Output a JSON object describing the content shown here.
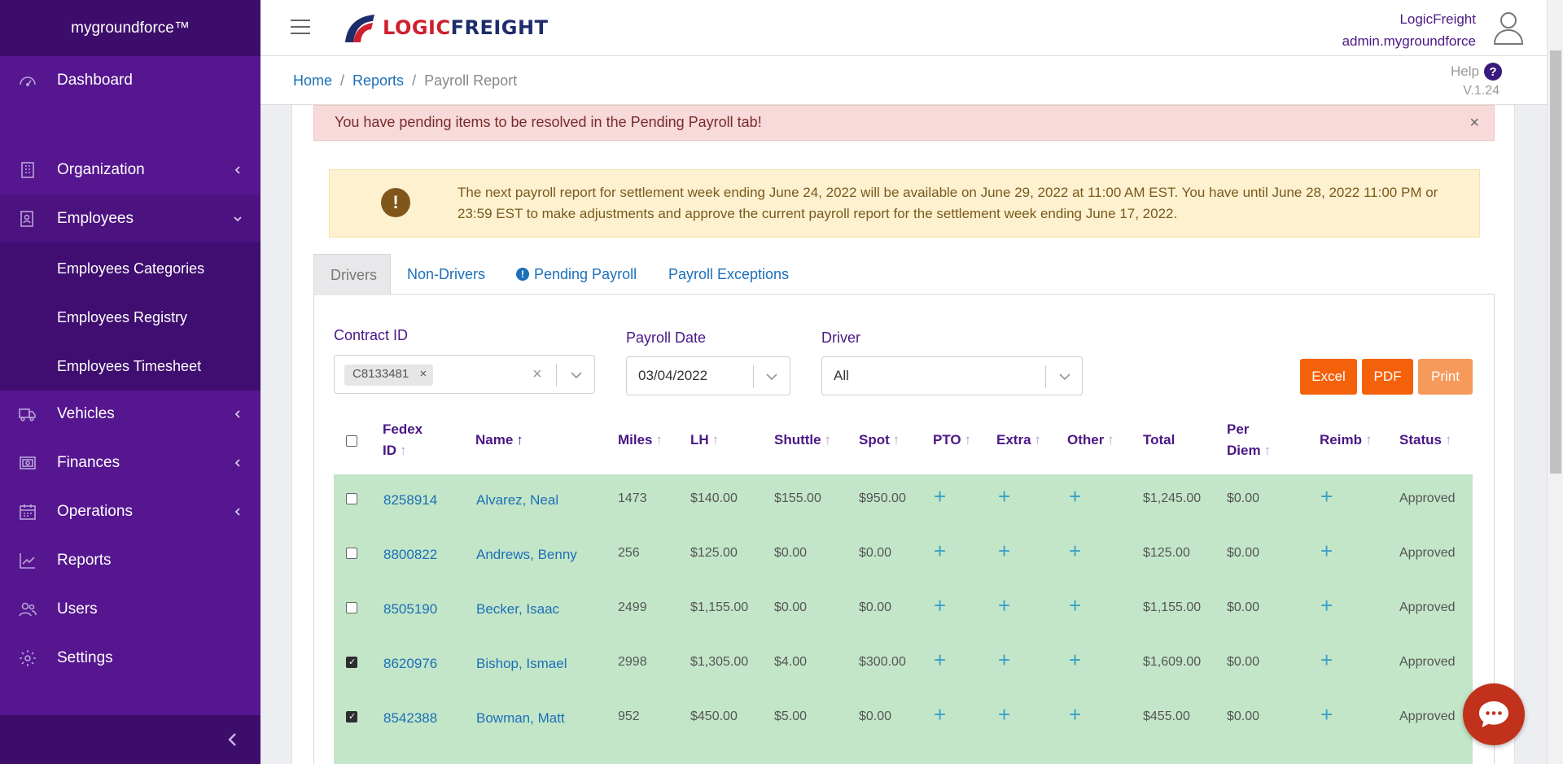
{
  "sidebar": {
    "brand": "mygroundforce™",
    "items": [
      {
        "label": "Dashboard",
        "icon": "dashboard-icon"
      },
      {
        "label": "Organization",
        "icon": "building-icon"
      },
      {
        "label": "Employees",
        "icon": "employees-icon"
      },
      {
        "label": "Vehicles",
        "icon": "truck-icon"
      },
      {
        "label": "Finances",
        "icon": "money-icon"
      },
      {
        "label": "Operations",
        "icon": "calendar-icon"
      },
      {
        "label": "Reports",
        "icon": "chart-icon"
      },
      {
        "label": "Users",
        "icon": "users-icon"
      },
      {
        "label": "Settings",
        "icon": "gear-icon"
      }
    ],
    "employees_sub": [
      "Employees Categories",
      "Employees Registry",
      "Employees Timesheet"
    ]
  },
  "topbar": {
    "logo_part1": "LOGIC",
    "logo_part2": "FREIGHT",
    "user_company": "LogicFreight",
    "user_account": "admin.mygroundforce"
  },
  "breadcrumb": {
    "home": "Home",
    "reports": "Reports",
    "current": "Payroll Report",
    "sep": "/"
  },
  "help": {
    "label": "Help",
    "icon": "?",
    "version": "V.1.24"
  },
  "alerts": {
    "pending": "You have pending items to be resolved in the Pending Payroll tab!",
    "close": "×",
    "notice": "The next payroll report for settlement week ending June 24, 2022 will be available on June 29, 2022 at 11:00 AM EST. You have until June 28, 2022 11:00 PM or 23:59 EST to make adjustments and approve the current payroll report for the settlement week ending June 17, 2022.",
    "notice_icon": "!"
  },
  "tabs": [
    {
      "label": "Drivers",
      "active": true
    },
    {
      "label": "Non-Drivers",
      "active": false
    },
    {
      "label": "Pending Payroll",
      "active": false,
      "warn": "!"
    },
    {
      "label": "Payroll Exceptions",
      "active": false
    }
  ],
  "filters": {
    "contract_label": "Contract ID",
    "contract_chip": "C8133481",
    "chip_remove": "×",
    "clear": "×",
    "date_label": "Payroll Date",
    "date_value": "03/04/2022",
    "driver_label": "Driver",
    "driver_value": "All"
  },
  "buttons": {
    "excel": "Excel",
    "pdf": "PDF",
    "print": "Print"
  },
  "table": {
    "headers": {
      "fedex_1": "Fedex",
      "fedex_2": "ID",
      "name": "Name",
      "miles": "Miles",
      "lh": "LH",
      "shuttle": "Shuttle",
      "spot": "Spot",
      "pto": "PTO",
      "extra": "Extra",
      "other": "Other",
      "total": "Total",
      "perdiem_1": "Per",
      "perdiem_2": "Diem",
      "reimb": "Reimb",
      "status": "Status",
      "arrow": "↑"
    },
    "plus": "+",
    "rows": [
      {
        "checked": false,
        "id": "8258914",
        "name": "Alvarez, Neal",
        "miles": "1473",
        "lh": "$140.00",
        "shuttle": "$155.00",
        "spot": "$950.00",
        "total": "$1,245.00",
        "perdiem": "$0.00",
        "status": "Approved"
      },
      {
        "checked": false,
        "id": "8800822",
        "name": "Andrews, Benny",
        "miles": "256",
        "lh": "$125.00",
        "shuttle": "$0.00",
        "spot": "$0.00",
        "total": "$125.00",
        "perdiem": "$0.00",
        "status": "Approved"
      },
      {
        "checked": false,
        "id": "8505190",
        "name": "Becker, Isaac",
        "miles": "2499",
        "lh": "$1,155.00",
        "shuttle": "$0.00",
        "spot": "$0.00",
        "total": "$1,155.00",
        "perdiem": "$0.00",
        "status": "Approved"
      },
      {
        "checked": true,
        "id": "8620976",
        "name": "Bishop, Ismael",
        "miles": "2998",
        "lh": "$1,305.00",
        "shuttle": "$4.00",
        "spot": "$300.00",
        "total": "$1,609.00",
        "perdiem": "$0.00",
        "status": "Approved"
      },
      {
        "checked": true,
        "id": "8542388",
        "name": "Bowman, Matt",
        "miles": "952",
        "lh": "$450.00",
        "shuttle": "$5.00",
        "spot": "$0.00",
        "total": "$455.00",
        "perdiem": "$0.00",
        "status": "Approved"
      }
    ]
  },
  "colors": {
    "sidebar": "#55168f",
    "sidebar_dark": "#3d0d6b",
    "accent_orange": "#f4610b",
    "row_green": "#c3e6c8",
    "link_blue": "#1c6fb8"
  }
}
